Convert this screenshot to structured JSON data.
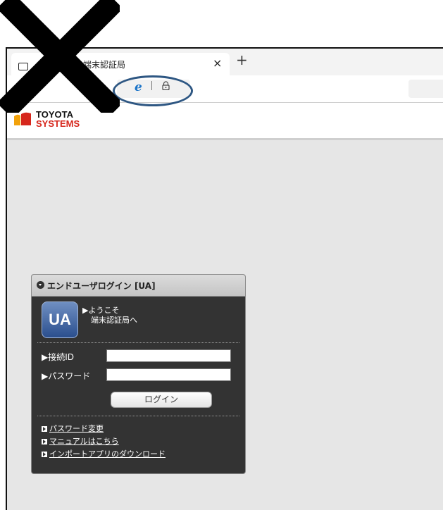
{
  "browser": {
    "tab_title": "端末認証局",
    "tab_close": "×",
    "new_tab": "+",
    "address_icons": [
      "ie-icon",
      "lock-icon"
    ]
  },
  "site": {
    "logo_line1": "TOYOTA",
    "logo_line2": "SYSTEMS"
  },
  "login_panel": {
    "title": "エンドユーザログイン [UA]",
    "badge": "UA",
    "welcome_line1": "▶ようこそ",
    "welcome_line2": "端末認証局へ",
    "id_label": "▶接続ID",
    "id_value": "",
    "password_label": "▶パスワード",
    "password_value": "",
    "login_button": "ログイン",
    "links": [
      "パスワード変更",
      "マニュアルはこちら",
      "インポートアプリのダウンロード"
    ]
  },
  "annotations": {
    "cross_color": "#000000",
    "oval_color": "#2e5783"
  }
}
